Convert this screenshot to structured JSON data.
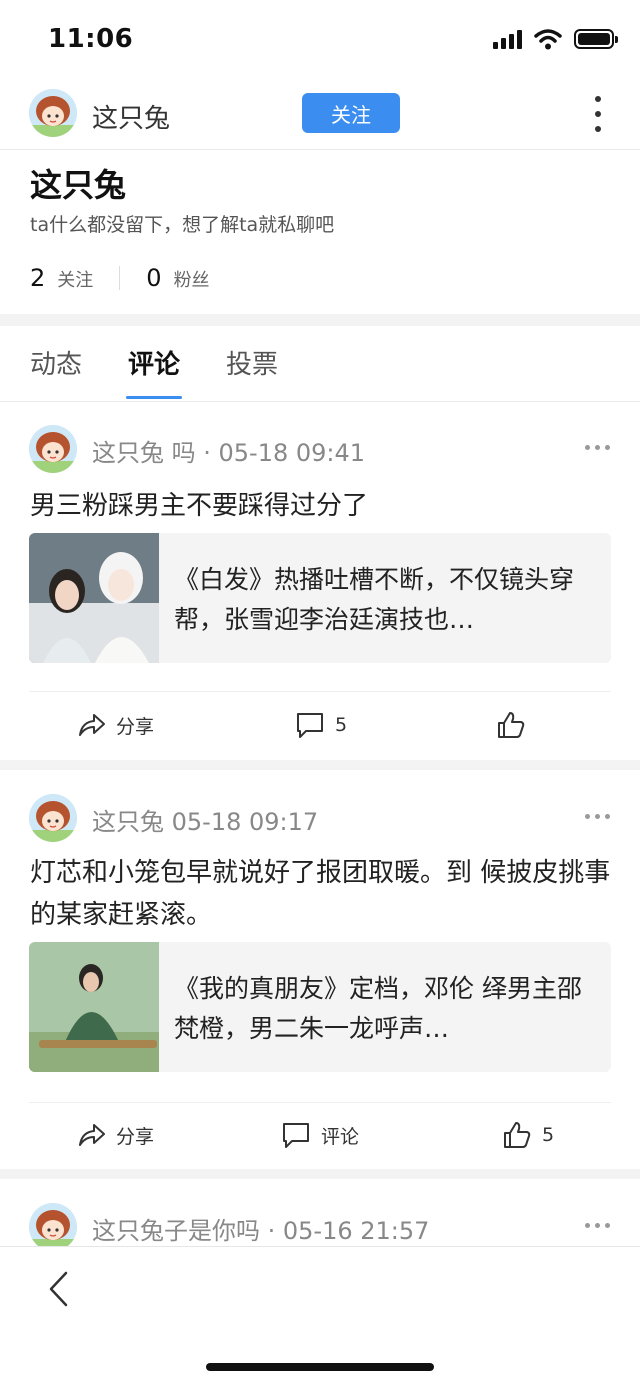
{
  "status_bar": {
    "time": "11:06"
  },
  "header": {
    "name": "这只兔",
    "follow_label": "关注"
  },
  "profile": {
    "name": "这只兔",
    "bio": "ta什么都没留下，想了解ta就私聊吧",
    "following_count": "2",
    "following_label": "关注",
    "followers_count": "0",
    "followers_label": "粉丝"
  },
  "tabs": [
    {
      "label": "动态",
      "active": false
    },
    {
      "label": "评论",
      "active": true
    },
    {
      "label": "投票",
      "active": false
    }
  ],
  "posts": [
    {
      "author_time": "这只兔 吗 · 05-18 09:41",
      "text": "男三粉踩男主不要踩得过分了",
      "article_title": "《白发》热播吐槽不断，不仅镜头穿帮，张雪迎李治廷演技也…",
      "share_label": "分享",
      "comment_label": "5",
      "like_label": ""
    },
    {
      "author_time": "这只兔 05-18 09:17",
      "text": "灯芯和小笼包早就说好了报团取暖。到 候披皮挑事的某家赶紧滚。",
      "article_title": "《我的真朋友》定档，邓伦 绎男主邵梵橙，男二朱一龙呼声…",
      "share_label": "分享",
      "comment_label": "评论",
      "like_label": "5"
    },
    {
      "author_time": "这只兔子是你吗 · 05-16 21:57"
    }
  ],
  "colors": {
    "accent": "#3b8ef0",
    "band": "#f3f3f3",
    "text": "#222222",
    "meta": "#888888"
  },
  "icons": [
    "signal-icon",
    "wifi-icon",
    "battery-icon",
    "more-vertical-icon",
    "more-horizontal-icon",
    "share-icon",
    "comment-icon",
    "like-icon",
    "back-icon"
  ]
}
